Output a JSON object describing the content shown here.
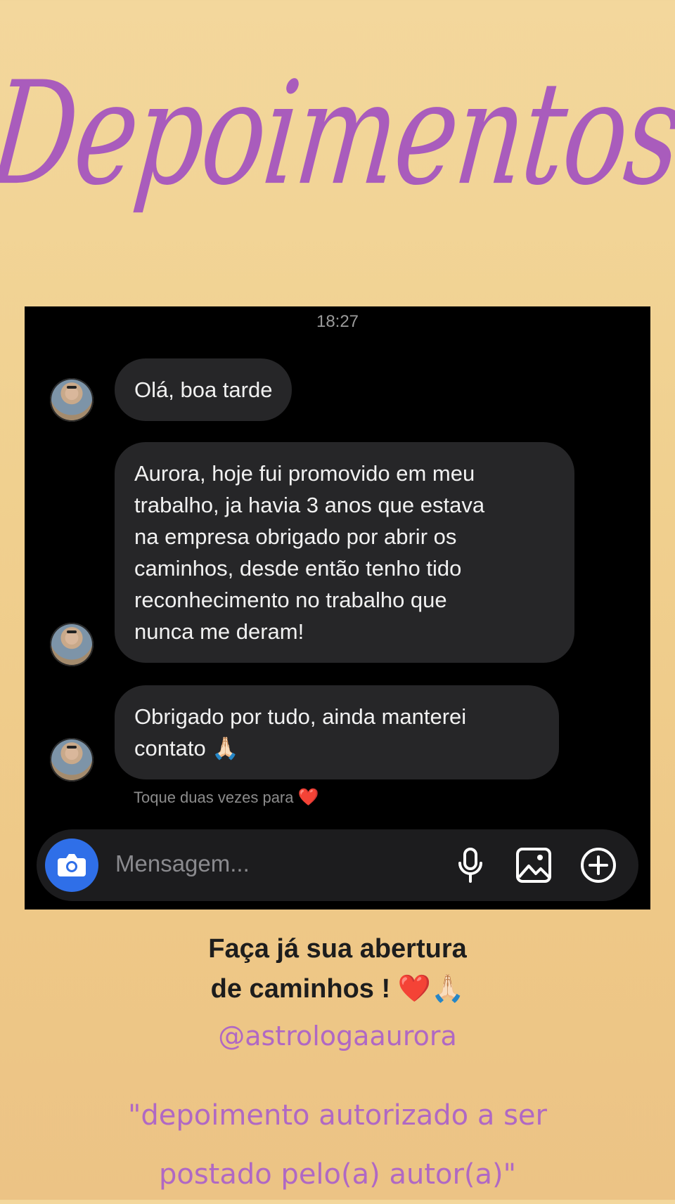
{
  "title": "Depoimentos",
  "chat": {
    "time": "18:27",
    "messages": [
      {
        "text": "Olá, boa tarde"
      },
      {
        "text": "Aurora, hoje fui promovido em meu\ntrabalho, ja havia 3 anos que estava\nna empresa obrigado por abrir os\ncaminhos, desde então tenho tido\nreconhecimento no trabalho que\nnunca me deram!"
      },
      {
        "text": "Obrigado por tudo, ainda manterei\ncontato 🙏🏻"
      }
    ],
    "hint": "Toque duas vezes para",
    "hint_icon": "❤️",
    "composer": {
      "placeholder": "Mensagem...",
      "camera_icon": "camera-icon",
      "mic_icon": "microphone-icon",
      "gallery_icon": "image-icon",
      "plus_icon": "plus-circle-icon",
      "accent_color": "#2f6fe8"
    }
  },
  "caption": "Faça já sua abertura\nde caminhos ! ❤️🙏🏻",
  "handle": "@astrologaaurora",
  "note": "\"depoimento autorizado a ser\npostado pelo(a) autor(a)\"",
  "colors": {
    "title": "#a95cbc",
    "handle": "#b068c4",
    "background": "#f0d08f",
    "bubble": "#262628"
  }
}
